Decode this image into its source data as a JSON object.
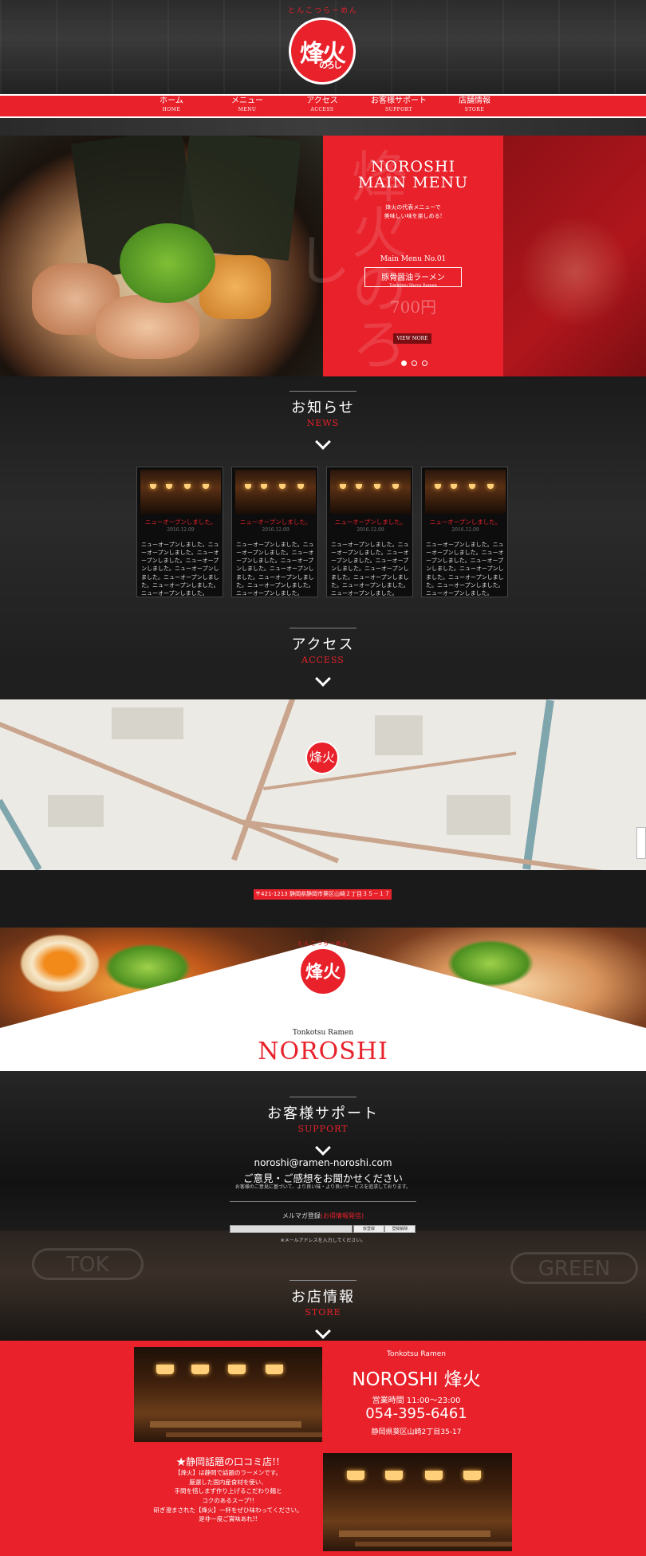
{
  "header": {
    "logo_tagline": "とんこつらーめん",
    "logo_text": "烽火",
    "logo_sub": "のろし"
  },
  "nav": [
    {
      "jp": "ホーム",
      "en": "HOME"
    },
    {
      "jp": "メニュー",
      "en": "MENU"
    },
    {
      "jp": "アクセス",
      "en": "ACCESS"
    },
    {
      "jp": "お客様サポート",
      "en": "SUPPORT"
    },
    {
      "jp": "店舗情報",
      "en": "STORE"
    }
  ],
  "hero": {
    "ghost": "烽火のろし",
    "title_line1": "NOROSHI",
    "title_line2": "MAIN MENU",
    "sub_line1": "烽火の代表メニューで",
    "sub_line2": "美味しい味を楽しめる!",
    "menu_no": "Main Menu No.01",
    "dish_jp": "豚骨醤油ラーメン",
    "dish_en": "Tonkotsu Shoyu Ramen",
    "price": "700円",
    "button": "VIEW MORE",
    "slides": 3,
    "active_slide": 1
  },
  "news": {
    "title_jp": "お知らせ",
    "title_en": "NEWS",
    "items": [
      {
        "title": "ニューオープンしました。",
        "date": "2016.12.09",
        "body": "ニューオープンしました。ニューオープンしました。ニューオープンしました。ニューオープンしました。ニューオープンしました。ニューオープンしました。ニューオープンしました。ニューオープンしました。"
      },
      {
        "title": "ニューオープンしました。",
        "date": "2016.12.09",
        "body": "ニューオープンしました。ニューオープンしました。ニューオープンしました。ニューオープンしました。ニューオープンしました。ニューオープンしました。ニューオープンしました。ニューオープンしました。"
      },
      {
        "title": "ニューオープンしました。",
        "date": "2016.12.09",
        "body": "ニューオープンしました。ニューオープンしました。ニューオープンしました。ニューオープンしました。ニューオープンしました。ニューオープンしました。ニューオープンしました。ニューオープンしました。"
      },
      {
        "title": "ニューオープンしました。",
        "date": "2016.12.09",
        "body": "ニューオープンしました。ニューオープンしました。ニューオープンしました。ニューオープンしました。ニューオープンしました。ニューオープンしました。ニューオープンしました。ニューオープンしました。"
      }
    ]
  },
  "access": {
    "title_jp": "アクセス",
    "title_en": "ACCESS",
    "address_badge": "〒421-1213 静岡県静岡市葵区山崎２丁目３５－１７",
    "map_pin": "烽火"
  },
  "brand": {
    "tagline": "とんこつらーめん",
    "logo": "烽火",
    "sub": "Tonkotsu Ramen",
    "name": "NOROSHI"
  },
  "support": {
    "title_jp": "お客様サポート",
    "title_en": "SUPPORT",
    "email": "noroshi@ramen-noroshi.com",
    "headline": "ご意見・ご感想をお聞かせください",
    "note": "お客様のご意見に基づいて、より良い味・より良いサービスを追求しております。",
    "magazine_label": "メルマガ登録",
    "magazine_red": "(お得情報発信)",
    "btn_register": "仮登録",
    "btn_cancel": "登録解除",
    "magazine_note": "※メールアドレスを入力してください。",
    "bg_sign1": "TOK",
    "bg_sign2": "GREEN"
  },
  "store": {
    "title_jp": "お店情報",
    "title_en": "STORE",
    "tag": "Tonkotsu Ramen",
    "name": "NOROSHI 烽火",
    "hours": "営業時間 11:00～23:00",
    "tel": "054-395-6461",
    "address": "静岡県葵区山崎2丁目35-17",
    "headline": "★静岡話題の口コミ店!!",
    "text_lines": [
      "【烽火】は静岡で話題のラーメンです。",
      "厳選した国内産食材を使い、",
      "手間を惜しまず作り上げるこだわり麺と",
      "コクのあるスープ!!",
      "研ぎ澄まされた【烽火】一杯をぜひ味わってください。",
      "是非一度ご賞味あれ!!"
    ]
  },
  "colors": {
    "accent": "#e8212a",
    "dark": "#141414"
  }
}
